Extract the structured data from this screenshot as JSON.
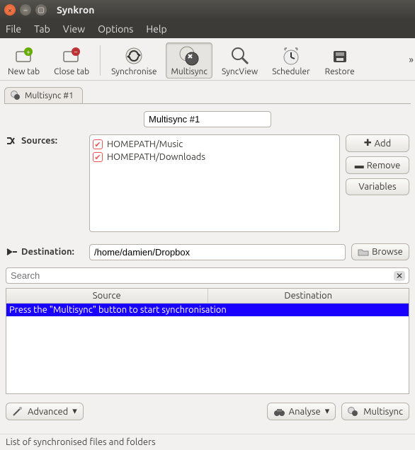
{
  "window": {
    "title": "Synkron"
  },
  "menu": {
    "items": [
      "File",
      "Tab",
      "View",
      "Options",
      "Help"
    ]
  },
  "toolbar": {
    "items": [
      {
        "label": "New tab"
      },
      {
        "label": "Close tab"
      },
      {
        "label": "Synchronise"
      },
      {
        "label": "Multisync",
        "selected": true
      },
      {
        "label": "SyncView"
      },
      {
        "label": "Scheduler"
      },
      {
        "label": "Restore"
      }
    ]
  },
  "tab": {
    "label": "Multisync #1"
  },
  "name_field": {
    "value": "Multisync #1"
  },
  "sources": {
    "label": "Sources:",
    "items": [
      {
        "path": "HOMEPATH/Music"
      },
      {
        "path": "HOMEPATH/Downloads"
      }
    ],
    "buttons": {
      "add": "Add",
      "remove": "Remove",
      "variables": "Variables"
    }
  },
  "destination": {
    "label": "Destination:",
    "value": "/home/damien/Dropbox",
    "browse": "Browse"
  },
  "search": {
    "placeholder": "Search"
  },
  "table": {
    "headers": [
      "Source",
      "Destination"
    ],
    "hint": "Press the \"Multisync\" button to start synchronisation"
  },
  "bottom": {
    "advanced": "Advanced",
    "analyse": "Analyse",
    "multisync": "Multisync"
  },
  "status": "List of synchronised files and folders"
}
